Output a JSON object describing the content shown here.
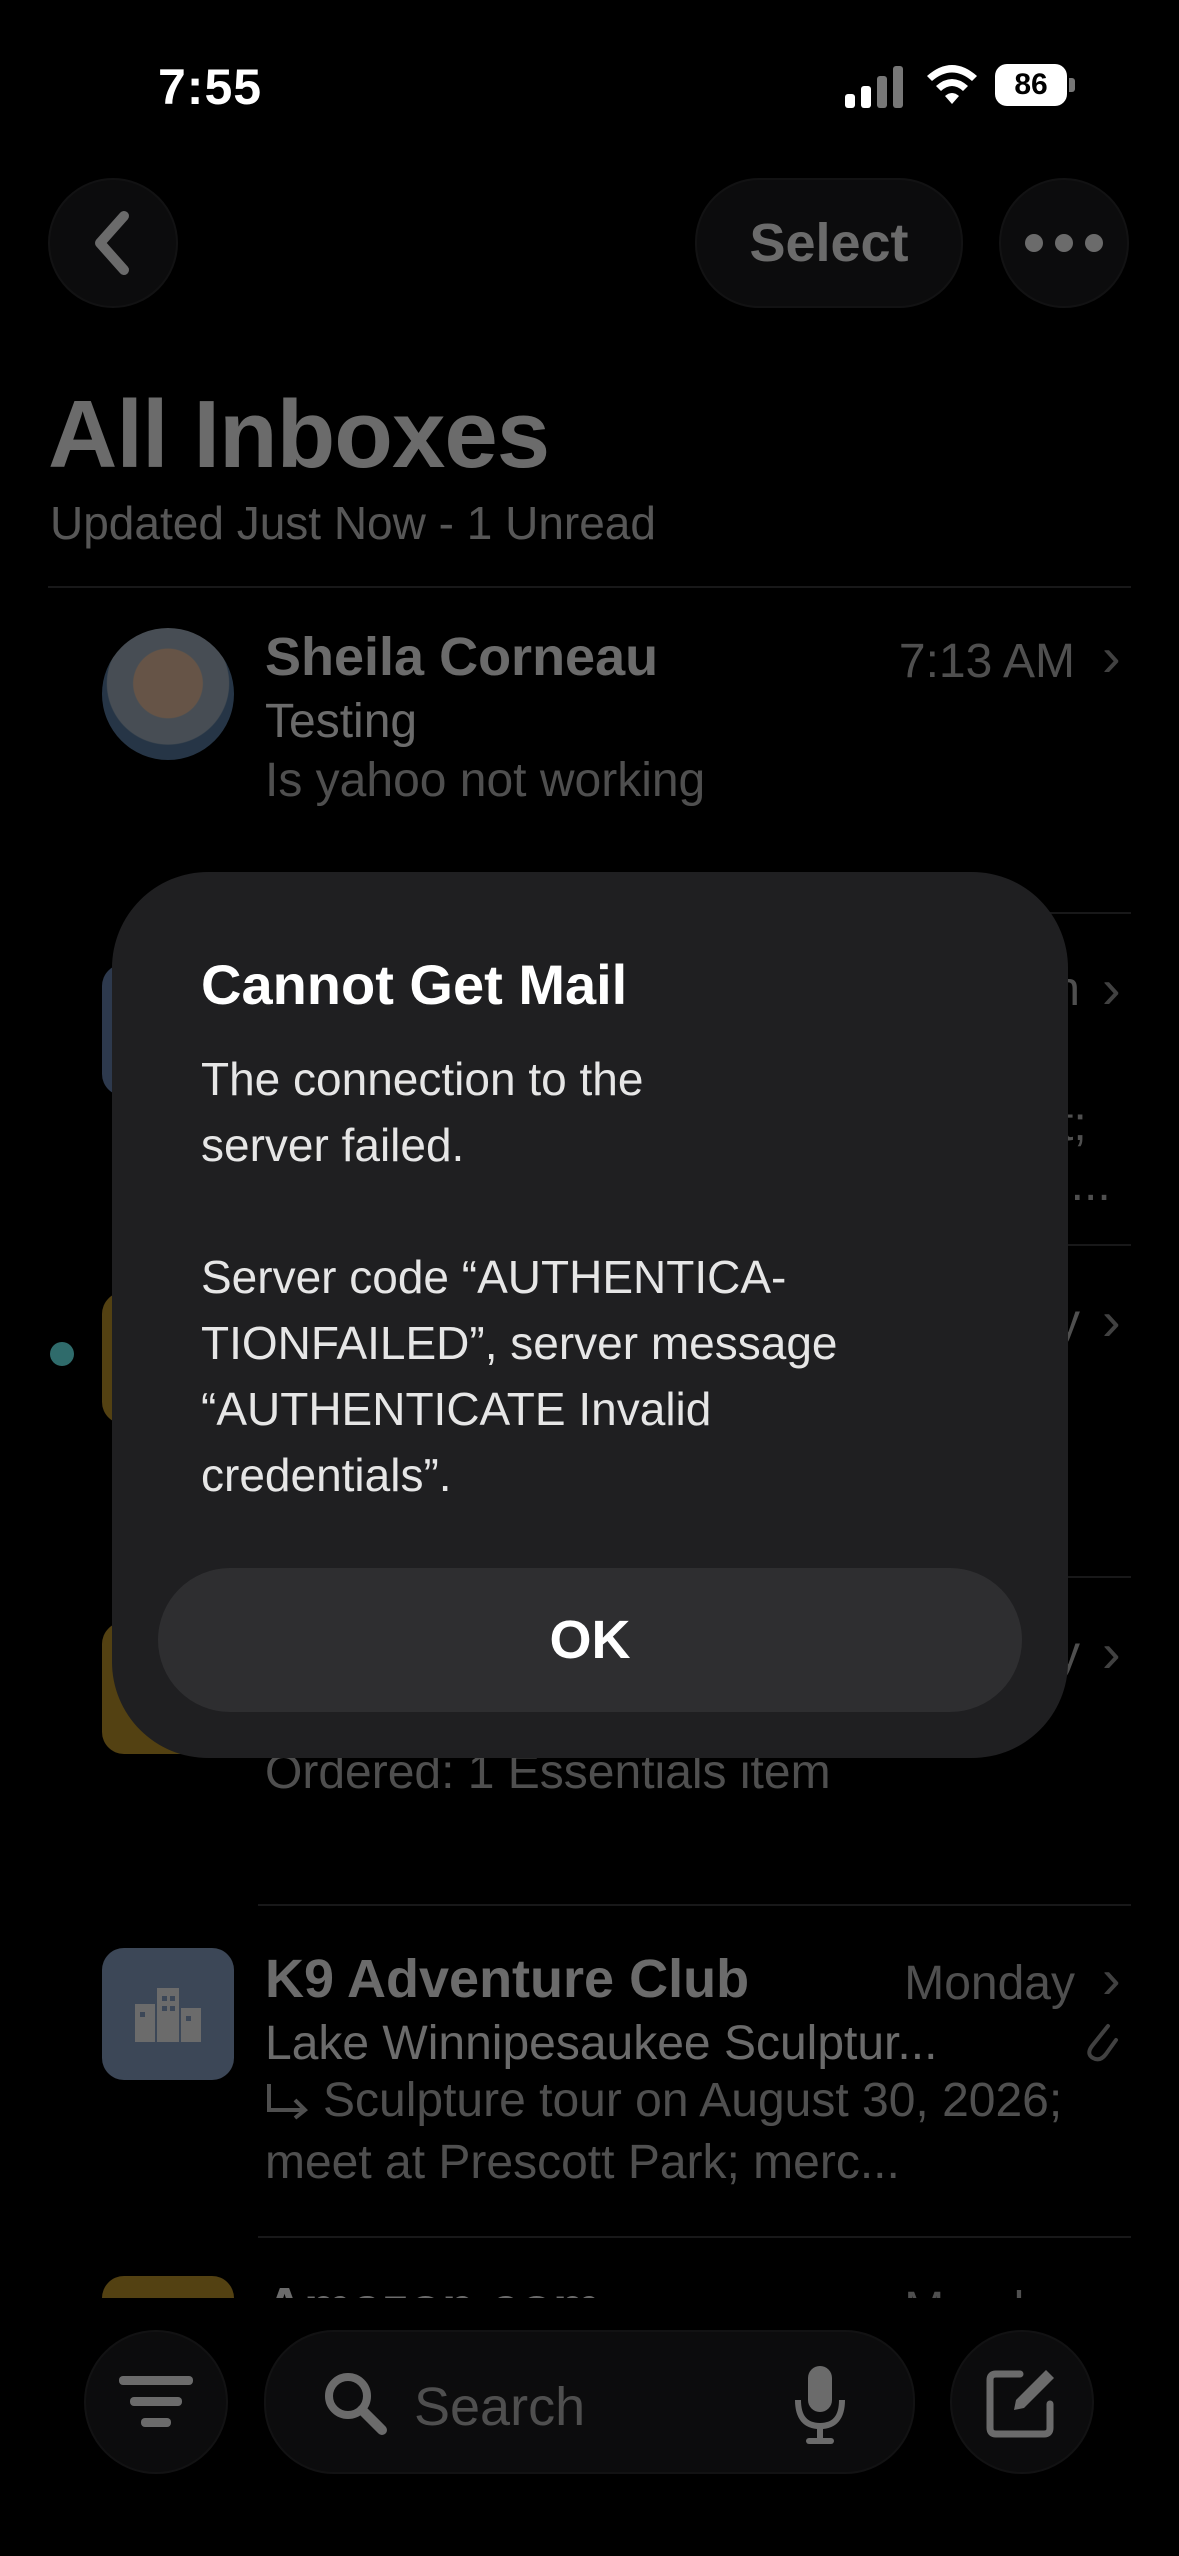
{
  "status_bar": {
    "time": "7:55",
    "battery": "86"
  },
  "nav": {
    "select_label": "Select"
  },
  "header": {
    "title": "All Inboxes",
    "subtitle": "Updated Just Now - 1 Unread"
  },
  "messages": [
    {
      "sender": "Sheila Corneau",
      "time": "7:13 AM",
      "subject": "Testing",
      "preview": "Is yahoo not working"
    },
    {
      "partial_time": "n",
      "preview_fragment_1": "t;",
      "preview_fragment_2": "l..."
    },
    {
      "partial_time": "y",
      "unread": true
    },
    {
      "partial_time": "y",
      "preview": "Ordered: 1 Essentials item"
    },
    {
      "sender": "K9 Adventure Club",
      "time": "Monday",
      "subject": "Lake Winnipesaukee Sculptur...",
      "preview": "Sculpture tour on August 30, 2026; meet at Prescott Park; merc..."
    },
    {
      "sender": "Amazon.com",
      "time": "Monday"
    }
  ],
  "toolbar": {
    "search_placeholder": "Search"
  },
  "alert": {
    "title": "Cannot Get Mail",
    "message": "The connection to the\nserver failed.\n\nServer code “AUTHENTICA-\nTIONFAILED”, server message\n“AUTHENTICATE Invalid\ncredentials”.",
    "ok_label": "OK"
  },
  "colors": {
    "unread_dot": "#2f7bf6",
    "alert_bg": "#1f1f21",
    "background": "#000000"
  },
  "icons": [
    "back-chevron-icon",
    "more-icon",
    "filter-icon",
    "search-icon",
    "microphone-icon",
    "compose-icon",
    "attachment-icon",
    "reply-icon",
    "building-icon"
  ]
}
